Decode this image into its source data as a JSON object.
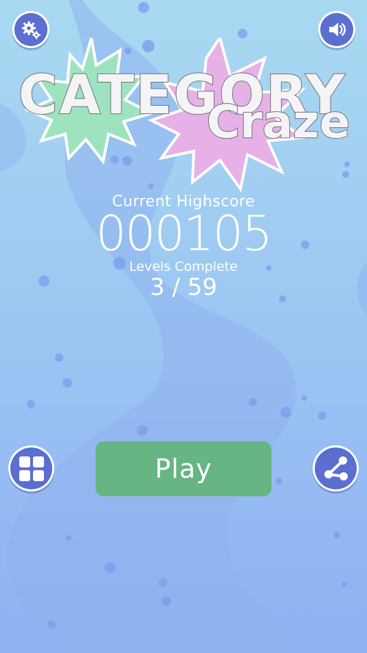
{
  "title": {
    "line1": "CATEGORY",
    "line2": "Craze"
  },
  "stats": {
    "highscore_label": "Current Highscore",
    "highscore_value": "000105",
    "levels_label": "Levels Complete",
    "levels_value": "3 / 59"
  },
  "buttons": {
    "play_label": "Play",
    "settings_icon": "gear-icon",
    "sound_icon": "speaker-icon",
    "levels_icon": "grid-icon",
    "share_icon": "share-icon"
  },
  "colors": {
    "button_blue": "#5a6fcf",
    "play_green": "#66b583",
    "burst_green": "#9ee3bf",
    "burst_pink": "#e6b1e6"
  }
}
